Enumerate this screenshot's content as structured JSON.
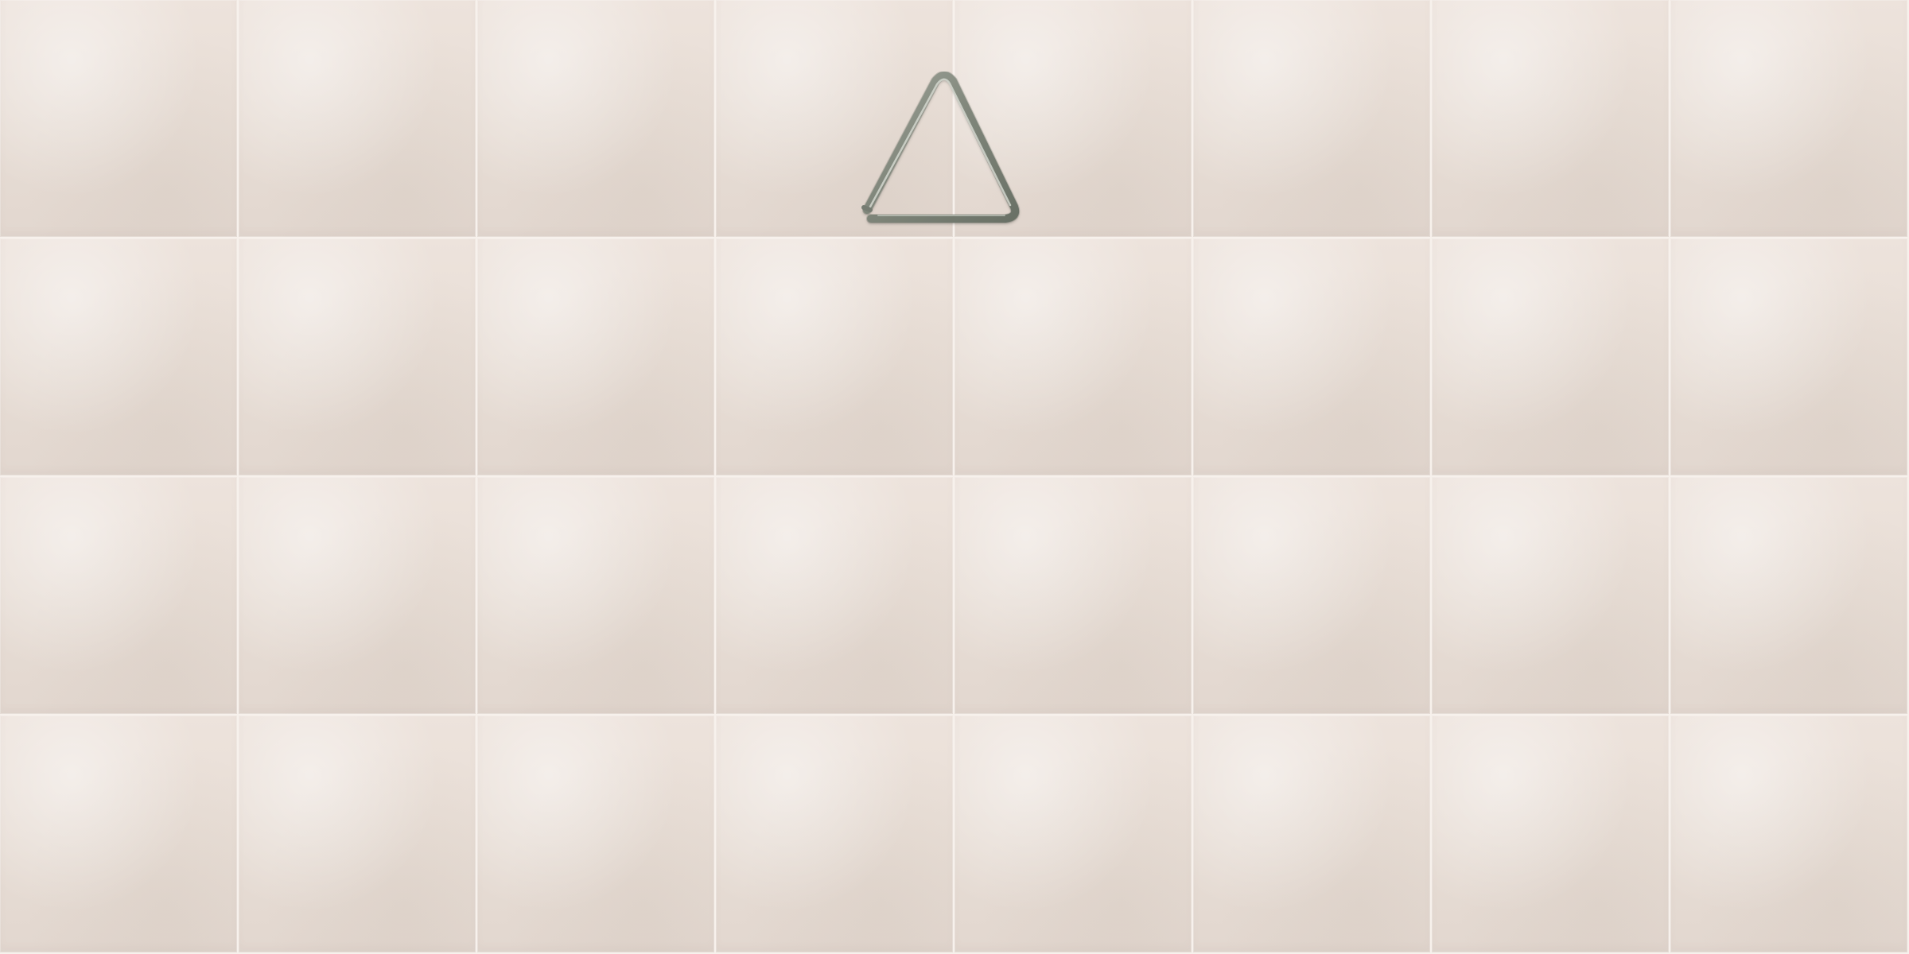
{
  "board": {
    "rows": 4,
    "columns": 8,
    "tile_color": "#e8ded6",
    "grout_color": "#f7f1ec"
  },
  "pieces": [
    {
      "icon": "triangle-instrument-icon",
      "row": 1,
      "column": 5,
      "metal_color": "#8f9589",
      "highlight_color": "#c7cbc2"
    }
  ]
}
